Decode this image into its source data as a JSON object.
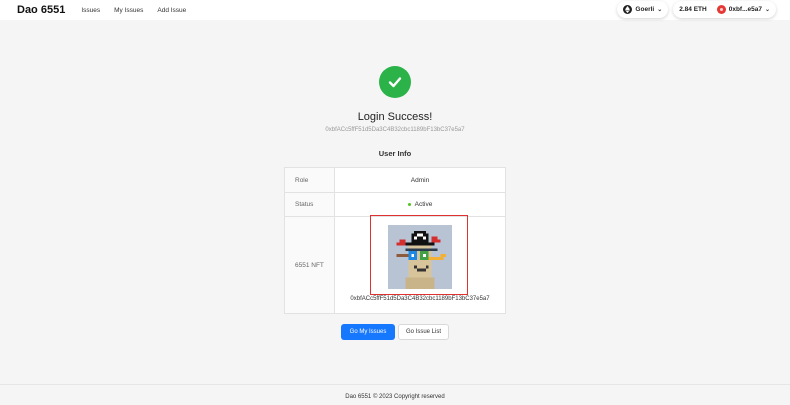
{
  "nav": {
    "brand": "Dao 6551",
    "links": [
      "Issues",
      "My Issues",
      "Add Issue"
    ],
    "network": "Goerli",
    "balance": "2.84 ETH",
    "account": "0xbf...e5a7"
  },
  "main": {
    "title": "Login Success!",
    "address": "0xbfACc5ffF51d5Da3C4B32cbc1189bF13bC37e5a7",
    "section_title": "User Info",
    "rows": [
      {
        "label": "Role",
        "value": "Admin"
      },
      {
        "label": "Status",
        "value": "Active"
      },
      {
        "label": "6551 NFT",
        "value": "0xbfACc5ffF51d5Da3C4B32cbc1189bF13bC37e5a7"
      }
    ],
    "buttons": {
      "primary": "Go My Issues",
      "secondary": "Go Issue List"
    }
  },
  "footer": {
    "text": "Dao 6551 © 2023 Copyright reserved"
  },
  "colors": {
    "success": "#2bb34a",
    "primary": "#1677ff",
    "status_active": "#52c41a",
    "highlight": "#e03131"
  },
  "icons": [
    "eth-icon",
    "chevron-down-icon",
    "account-avatar",
    "check-icon",
    "nft-image"
  ]
}
